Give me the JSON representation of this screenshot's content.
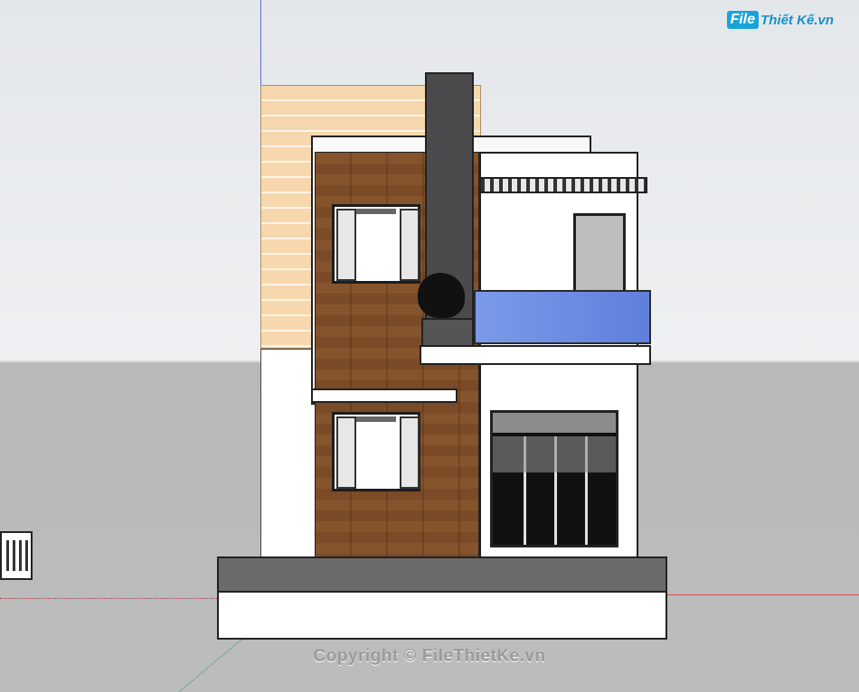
{
  "watermark": {
    "logo_file": "File",
    "logo_text": "Thiết Kế.vn",
    "copyright": "Copyright © FileThietKe.vn"
  },
  "colors": {
    "sky": "#e8eaec",
    "ground": "#bcbcbc",
    "siding": "#f7d7ad",
    "wood": "#86542c",
    "glass": "#6a8ae0",
    "axis_blue": "#5b6bd6",
    "axis_red": "#d64c4c",
    "logo_blue": "#1aa3d9"
  },
  "scene": {
    "name": "3d-house-model-viewport"
  }
}
